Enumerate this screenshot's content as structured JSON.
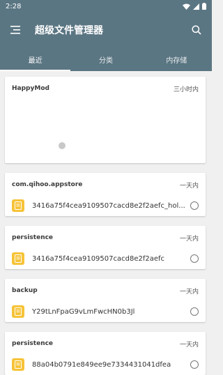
{
  "status_bar": {
    "time": "2:28"
  },
  "app": {
    "title": "超级文件管理器"
  },
  "tabs": [
    {
      "label": "最近",
      "active": true
    },
    {
      "label": "分类",
      "active": false
    },
    {
      "label": "内存储",
      "active": false
    }
  ],
  "cards": [
    {
      "source": "HappyMod",
      "time": "三小时内",
      "files": []
    },
    {
      "source": "com.qihoo.appstore",
      "time": "一天内",
      "files": [
        {
          "name": "3416a75f4cea9109507cacd8e2f2aefc_hol..."
        }
      ]
    },
    {
      "source": "persistence",
      "time": "一天内",
      "files": [
        {
          "name": "3416a75f4cea9109507cacd8e2f2aefc"
        }
      ]
    },
    {
      "source": "backup",
      "time": "一天内",
      "files": [
        {
          "name": "Y29tLnFpaG9vLmFwcHN0b3Jl"
        }
      ]
    },
    {
      "source": "persistence",
      "time": "一天内",
      "files": [
        {
          "name": "88a04b0791e849ee9e7334431041dfea"
        }
      ]
    }
  ],
  "colors": {
    "appbar": "#5b7683",
    "file_icon": "#f6c338"
  }
}
